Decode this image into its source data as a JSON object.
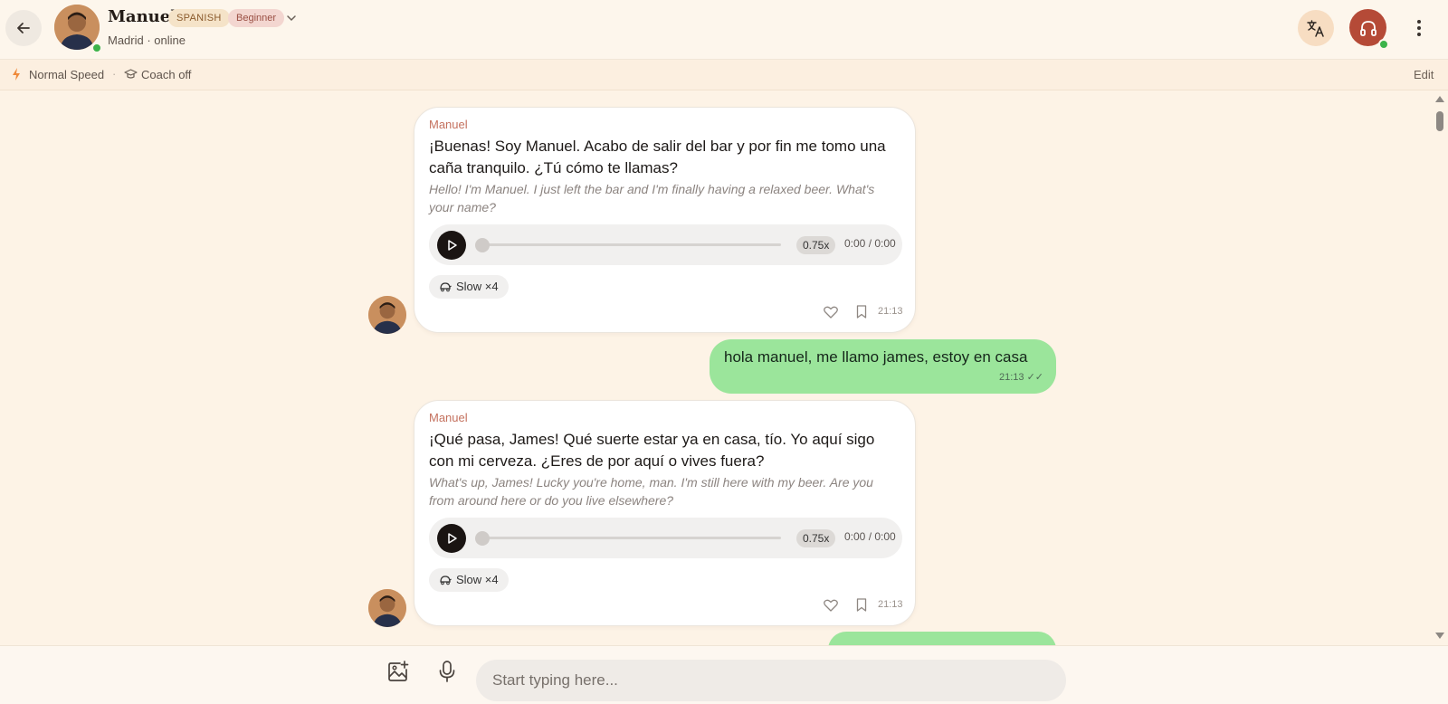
{
  "header": {
    "name": "Manuel",
    "language_badge": "SPANISH",
    "level_badge": "Beginner",
    "subtitle": "Madrid · online"
  },
  "subbar": {
    "speed": "Normal Speed",
    "separator": "·",
    "coach": "Coach off",
    "edit": "Edit"
  },
  "messages": [
    {
      "type": "incoming",
      "sender": "Manuel",
      "text": "¡Buenas! Soy Manuel. Acabo de salir del bar y por fin me tomo una caña tranquilo. ¿Tú cómo te llamas?",
      "translation": "Hello! I'm Manuel. I just left the bar and I'm finally having a relaxed beer. What's your name?",
      "audio_rate": "0.75x",
      "audio_time": "0:00 / 0:00",
      "audio_progress": 0,
      "slow_label": "Slow ×4",
      "time": "21:13"
    },
    {
      "type": "outgoing",
      "text": "hola manuel, me llamo james, estoy en casa",
      "time": "21:13",
      "status": "✓✓"
    },
    {
      "type": "incoming",
      "sender": "Manuel",
      "text": "¡Qué pasa, James! Qué suerte estar ya en casa, tío. Yo aquí sigo con mi cerveza. ¿Eres de por aquí o vives fuera?",
      "translation": "What's up, James! Lucky you're home, man. I'm still here with my beer. Are you from around here or do you live elsewhere?",
      "audio_rate": "0.75x",
      "audio_time": "0:00 / 0:00",
      "audio_progress": 0,
      "slow_label": "Slow ×4",
      "time": "21:13"
    }
  ],
  "composer": {
    "placeholder": "Start typing here..."
  },
  "colors": {
    "accent": "#b54a37",
    "outgoing_bubble": "#9be59b",
    "online": "#3cb34a"
  }
}
